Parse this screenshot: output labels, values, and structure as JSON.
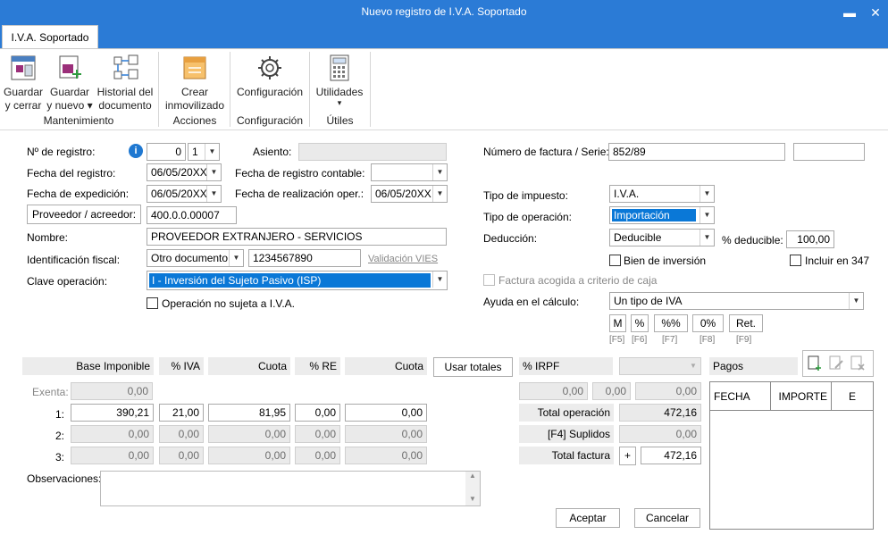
{
  "window": {
    "title": "Nuevo registro de I.V.A. Soportado",
    "minimize": "▬",
    "close": "✕"
  },
  "tab": "I.V.A. Soportado",
  "ribbon": {
    "guardar_cerrar": [
      "Guardar",
      "y cerrar"
    ],
    "guardar_nuevo": [
      "Guardar",
      "y nuevo ▾"
    ],
    "historial": [
      "Historial del",
      "documento"
    ],
    "crear": [
      "Crear",
      "inmovilizado"
    ],
    "configuracion": "Configuración",
    "utilidades": "Utilidades",
    "utilidades_arrow": "▾",
    "groups": {
      "mantenimiento": "Mantenimiento",
      "acciones": "Acciones",
      "configuracion": "Configuración",
      "utiles": "Útiles"
    }
  },
  "form": {
    "n_registro_label": "Nº de registro:",
    "n_registro_value": "0",
    "n_registro_serie": "1",
    "asiento_label": "Asiento:",
    "asiento_value": "",
    "fecha_registro_label": "Fecha del registro:",
    "fecha_registro_value": "06/05/20XX",
    "fecha_contable_label": "Fecha de registro contable:",
    "fecha_contable_value": "",
    "fecha_expedicion_label": "Fecha de expedición:",
    "fecha_expedicion_value": "06/05/20XX",
    "fecha_realizacion_label": "Fecha de realización oper.:",
    "fecha_realizacion_value": "06/05/20XX",
    "proveedor_button": "Proveedor / acreedor:",
    "proveedor_value": "400.0.0.00007",
    "nombre_label": "Nombre:",
    "nombre_value": "PROVEEDOR EXTRANJERO - SERVICIOS",
    "ident_label": "Identificación fiscal:",
    "ident_tipo": "Otro documento",
    "ident_value": "1234567890",
    "validacion_vies": "Validación VIES",
    "clave_label": "Clave operación:",
    "clave_value": "I - Inversión del Sujeto Pasivo (ISP)",
    "no_sujeta_label": "Operación no sujeta a I.V.A.",
    "factura_label": "Número de factura / Serie:",
    "factura_value": "852/89",
    "factura_serie": "",
    "tipo_impuesto_label": "Tipo de impuesto:",
    "tipo_impuesto_value": "I.V.A.",
    "tipo_operacion_label": "Tipo de operación:",
    "tipo_operacion_value": "Importación",
    "deduccion_label": "Deducción:",
    "deduccion_value": "Deducible",
    "pct_deducible_label": "% deducible:",
    "pct_deducible_value": "100,00",
    "bien_inversion": "Bien de inversión",
    "incluir_347": "Incluir en 347",
    "criterio_caja": "Factura acogida a criterio de caja",
    "ayuda_label": "Ayuda en el cálculo:",
    "ayuda_value": "Un tipo de IVA",
    "calc_buttons": [
      "M",
      "%",
      "%%",
      "0%",
      "Ret."
    ],
    "calc_keys": [
      "[F5]",
      "[F6]",
      "[F7]",
      "[F8]",
      "[F9]"
    ]
  },
  "table": {
    "headers": {
      "base": "Base Imponible",
      "piva": "% IVA",
      "cuota": "Cuota",
      "pre": "% RE",
      "cuota_re": "Cuota"
    },
    "usar_totales": "Usar totales",
    "irpf_label": "% IRPF",
    "exenta_label": "Exenta:",
    "exenta_value": "0,00",
    "rows": [
      {
        "n": "1:",
        "base": "390,21",
        "piva": "21,00",
        "cuota": "81,95",
        "pre": "0,00",
        "cuota_re": "0,00"
      },
      {
        "n": "2:",
        "base": "0,00",
        "piva": "0,00",
        "cuota": "0,00",
        "pre": "0,00",
        "cuota_re": "0,00"
      },
      {
        "n": "3:",
        "base": "0,00",
        "piva": "0,00",
        "cuota": "0,00",
        "pre": "0,00",
        "cuota_re": "0,00"
      }
    ],
    "irpf_values": [
      "0,00",
      "0,00",
      "0,00"
    ],
    "total_operacion_label": "Total operación",
    "total_operacion_value": "472,16",
    "suplidos_label": "[F4] Suplidos",
    "suplidos_value": "0,00",
    "total_factura_label": "Total factura",
    "total_factura_sign": "+",
    "total_factura_value": "472,16"
  },
  "pagos": {
    "label": "Pagos",
    "cols": [
      "FECHA",
      "IMPORTE",
      "E"
    ]
  },
  "observaciones_label": "Observaciones:",
  "footer": {
    "aceptar": "Aceptar",
    "cancelar": "Cancelar"
  }
}
